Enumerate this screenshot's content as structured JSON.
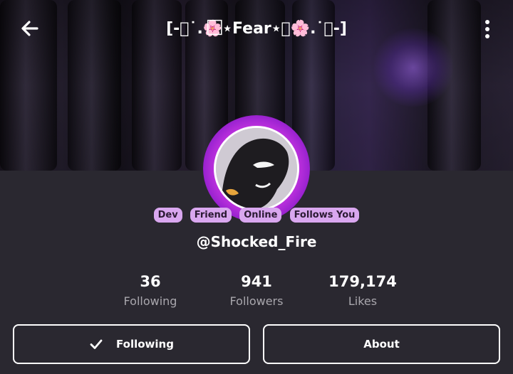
{
  "header": {
    "title": "[-⃞˙.🌸⃞⋆Fear⋆⃞🌸.˙⃞-]",
    "back_icon": "back-arrow-icon",
    "more_icon": "more-vertical-icon"
  },
  "profile": {
    "handle": "@Shocked_Fire",
    "badges": [
      "Dev",
      "Friend",
      "Online",
      "Follows You"
    ],
    "badge_color": "#d9a7ef"
  },
  "stats": [
    {
      "value": "36",
      "label": "Following"
    },
    {
      "value": "941",
      "label": "Followers"
    },
    {
      "value": "179,174",
      "label": "Likes"
    }
  ],
  "actions": {
    "following_label": "Following",
    "about_label": "About"
  },
  "colors": {
    "background": "#2a2830",
    "avatar_glow": "#d43be6"
  }
}
